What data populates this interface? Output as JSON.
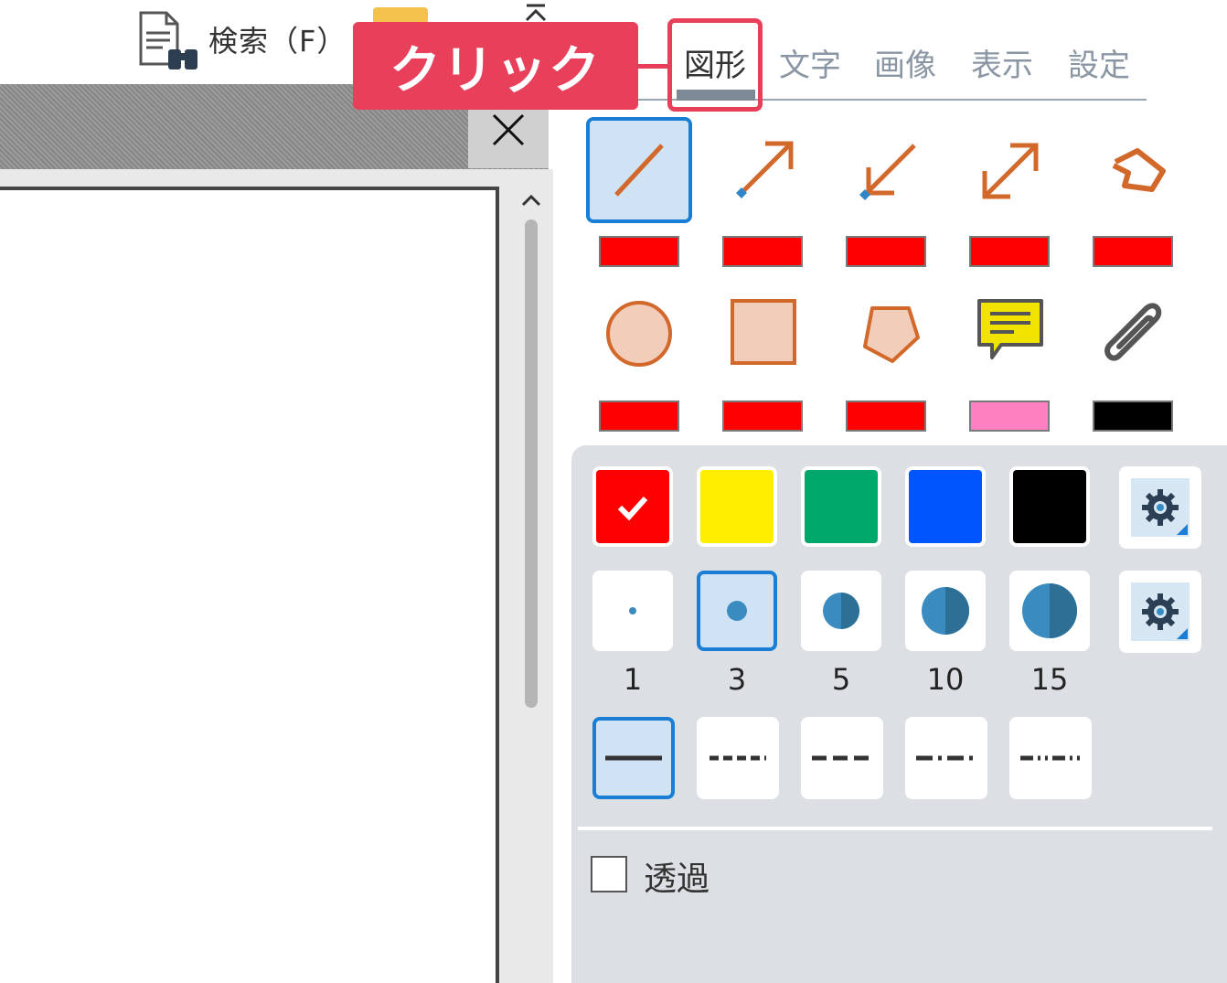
{
  "toolbar": {
    "search_label": "検索（F）",
    "search_icon": "search-document-icon",
    "folder_icon": "folder-icon"
  },
  "document": {
    "close_icon": "close-icon"
  },
  "tabs": [
    {
      "label": "図形",
      "active": true
    },
    {
      "label": "文字",
      "active": false
    },
    {
      "label": "画像",
      "active": false
    },
    {
      "label": "表示",
      "active": false
    },
    {
      "label": "設定",
      "active": false
    }
  ],
  "callout": {
    "text": "クリック",
    "color": "#e8405a"
  },
  "shape_tools_row1": [
    {
      "name": "line-tool",
      "icon": "line-icon",
      "color": "#ff0000",
      "selected": true
    },
    {
      "name": "arrow-tool",
      "icon": "arrow-end-icon",
      "color": "#ff0000",
      "selected": false
    },
    {
      "name": "arrow-start-tool",
      "icon": "arrow-start-icon",
      "color": "#ff0000",
      "selected": false
    },
    {
      "name": "double-arrow-tool",
      "icon": "double-arrow-icon",
      "color": "#ff0000",
      "selected": false
    },
    {
      "name": "polyline-tool",
      "icon": "polyline-icon",
      "color": "#ff0000",
      "selected": false
    }
  ],
  "shape_tools_row2": [
    {
      "name": "ellipse-tool",
      "icon": "ellipse-icon",
      "color": "#ff0000"
    },
    {
      "name": "rectangle-tool",
      "icon": "rectangle-icon",
      "color": "#ff0000"
    },
    {
      "name": "polygon-tool",
      "icon": "polygon-icon",
      "color": "#ff0000"
    },
    {
      "name": "note-tool",
      "icon": "note-icon",
      "color": "#ff80c0"
    },
    {
      "name": "attachment-tool",
      "icon": "paperclip-icon",
      "color": "#000000"
    }
  ],
  "colors": [
    {
      "hex": "#ff0000",
      "selected": true
    },
    {
      "hex": "#ffee00",
      "selected": false
    },
    {
      "hex": "#00a86b",
      "selected": false
    },
    {
      "hex": "#0055ff",
      "selected": false
    },
    {
      "hex": "#000000",
      "selected": false
    }
  ],
  "line_widths": [
    {
      "label": "1",
      "selected": false
    },
    {
      "label": "3",
      "selected": true
    },
    {
      "label": "5",
      "selected": false
    },
    {
      "label": "10",
      "selected": false
    },
    {
      "label": "15",
      "selected": false
    }
  ],
  "line_styles": [
    {
      "name": "solid",
      "selected": true
    },
    {
      "name": "dotted",
      "selected": false
    },
    {
      "name": "dashed",
      "selected": false
    },
    {
      "name": "dash-dot",
      "selected": false
    },
    {
      "name": "dash-dot-dot",
      "selected": false
    }
  ],
  "transparency": {
    "label": "透過",
    "checked": false
  }
}
